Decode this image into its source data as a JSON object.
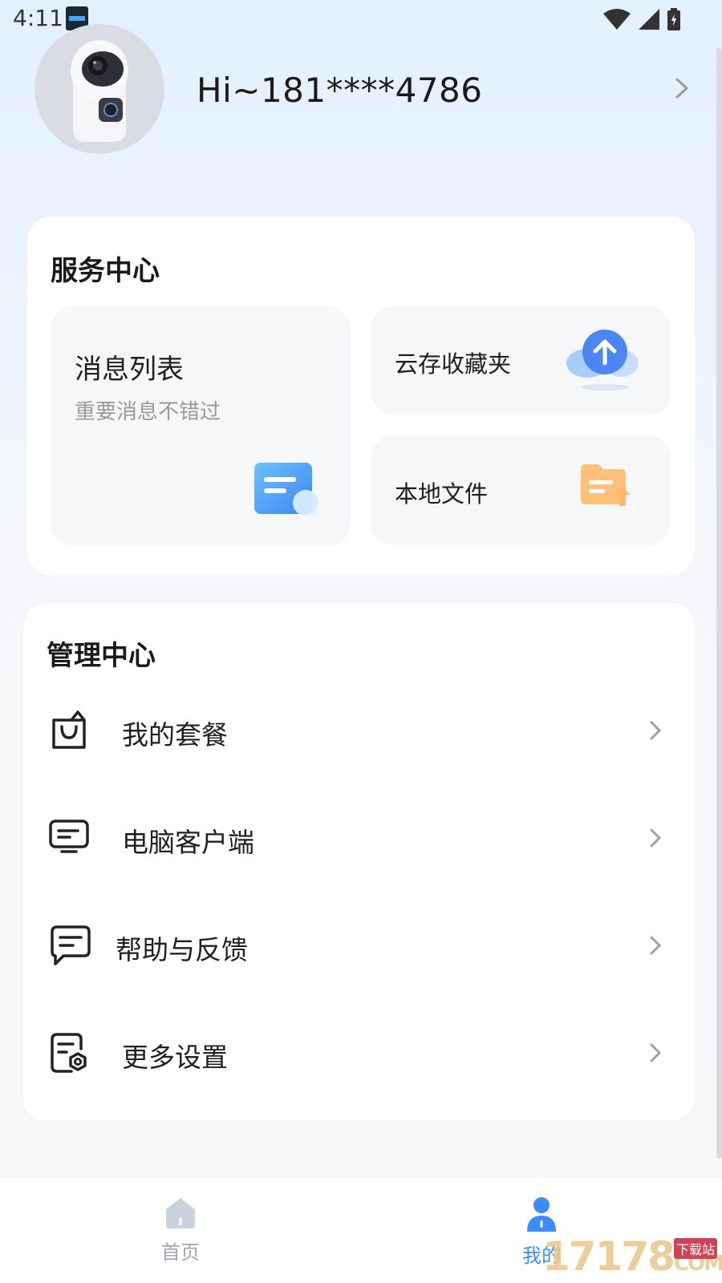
{
  "status_bar": {
    "time": "4:11"
  },
  "profile": {
    "greeting": "Hi~181****4786"
  },
  "service_center": {
    "title": "服务中心",
    "message_list": {
      "title": "消息列表",
      "subtitle": "重要消息不错过"
    },
    "cloud_favorites": {
      "label": "云存收藏夹"
    },
    "local_files": {
      "label": "本地文件"
    }
  },
  "management_center": {
    "title": "管理中心",
    "items": [
      {
        "label": "我的套餐",
        "icon": "shopping-bag-icon"
      },
      {
        "label": "电脑客户端",
        "icon": "monitor-icon"
      },
      {
        "label": "帮助与反馈",
        "icon": "chat-bubble-icon"
      },
      {
        "label": "更多设置",
        "icon": "settings-document-icon"
      }
    ]
  },
  "tab_bar": {
    "tabs": [
      {
        "label": "首页",
        "icon": "home-icon",
        "active": false
      },
      {
        "label": "我的",
        "icon": "user-icon",
        "active": true
      }
    ]
  },
  "watermark": {
    "text": "17178",
    "badge": "下载站",
    "suffix": "COM"
  },
  "colors": {
    "accent": "#3d8bff",
    "inactive": "#9ea7b3",
    "text": "#1f1f1f"
  }
}
